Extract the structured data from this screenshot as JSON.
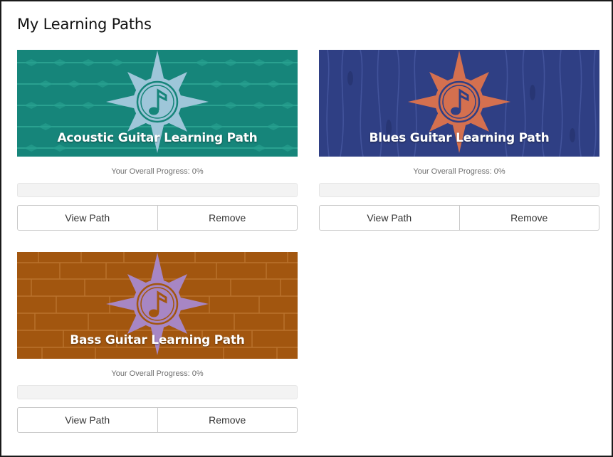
{
  "page": {
    "title": "My Learning Paths"
  },
  "paths": [
    {
      "title": "Acoustic Guitar Learning Path",
      "progress_label": "Your Overall Progress: 0%",
      "progress": 0,
      "view_label": "View Path",
      "remove_label": "Remove",
      "banner_color": "#16857a",
      "compass_color": "#9ec6d9",
      "pattern": "feathers"
    },
    {
      "title": "Blues Guitar Learning Path",
      "progress_label": "Your Overall Progress: 0%",
      "progress": 0,
      "view_label": "View Path",
      "remove_label": "Remove",
      "banner_color": "#2f3f84",
      "compass_color": "#d4704f",
      "pattern": "woodgrain"
    },
    {
      "title": "Bass Guitar Learning Path",
      "progress_label": "Your Overall Progress: 0%",
      "progress": 0,
      "view_label": "View Path",
      "remove_label": "Remove",
      "banner_color": "#a2560f",
      "compass_color": "#a786c4",
      "pattern": "bricks"
    }
  ]
}
